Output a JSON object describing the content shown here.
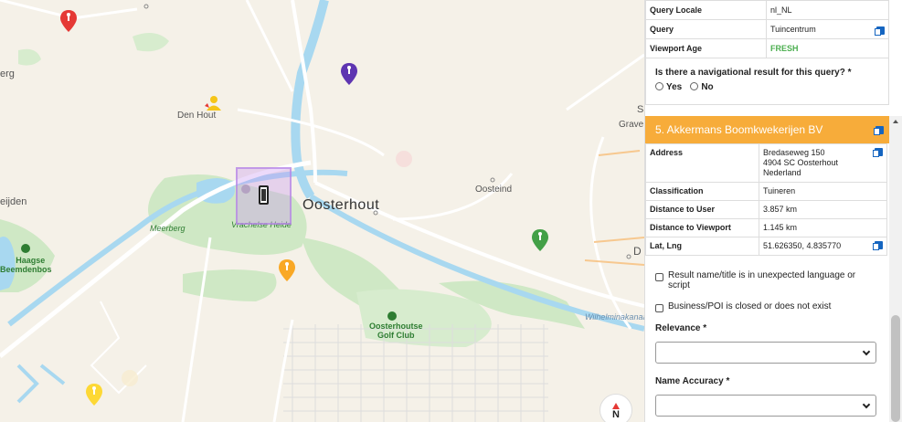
{
  "map": {
    "labels": {
      "erg": "erg",
      "den_hout": "Den Hout",
      "oosterhout": "Oosterhout",
      "oosteind": "Oosteind",
      "graven": "Grave",
      "eijden": "eijden",
      "meerberg": "Meerberg",
      "vrachelse_heide": "Vrachelse Heide",
      "haagse_beemdenbos": [
        "Haagse",
        "Beemdenbos"
      ],
      "oosterhoutse_golf_club": [
        "Oosterhoutse",
        "Golf Club"
      ],
      "wilhelminakanaal": "Wilhelminakanaa",
      "d_label": "D",
      "s_label": "S"
    },
    "compass_label": "N",
    "colors": {
      "water": "#a8d8f0",
      "green": "#cfe8c5",
      "road_major": "#ffffff",
      "road_orange": "#f7c88f"
    },
    "pins": [
      {
        "name": "red-pin",
        "color": "#e53935"
      },
      {
        "name": "purple-pin",
        "color": "#5e35b1"
      },
      {
        "name": "green-pin",
        "color": "#43a047"
      },
      {
        "name": "orange-pin",
        "color": "#f9a825"
      },
      {
        "name": "yellow-pin",
        "color": "#fdd835"
      }
    ]
  },
  "query_info": {
    "rows": [
      {
        "key": "Query Locale",
        "value": "nl_NL"
      },
      {
        "key": "Query",
        "value": "Tuincentrum"
      },
      {
        "key": "Viewport Age",
        "value": "FRESH"
      }
    ],
    "nav_question": "Is there a navigational result for this query? *",
    "yes_label": "Yes",
    "no_label": "No"
  },
  "result": {
    "header": "5. Akkermans Boomkwekerijen BV",
    "address_key": "Address",
    "address_lines": [
      "Bredaseweg 150",
      "4904 SC Oosterhout",
      "Nederland"
    ],
    "details": [
      {
        "key": "Classification",
        "value": "Tuineren"
      },
      {
        "key": "Distance to User",
        "value": "3.857 km"
      },
      {
        "key": "Distance to Viewport",
        "value": "1.145 km"
      },
      {
        "key": "Lat, Lng",
        "value": "51.626350, 4.835770"
      }
    ],
    "checkbox_language": "Result name/title is in unexpected language or script",
    "checkbox_closed": "Business/POI is closed or does not exist",
    "relevance_label": "Relevance *",
    "name_accuracy_label": "Name Accuracy *"
  },
  "accent_color": "#f7ac3a"
}
